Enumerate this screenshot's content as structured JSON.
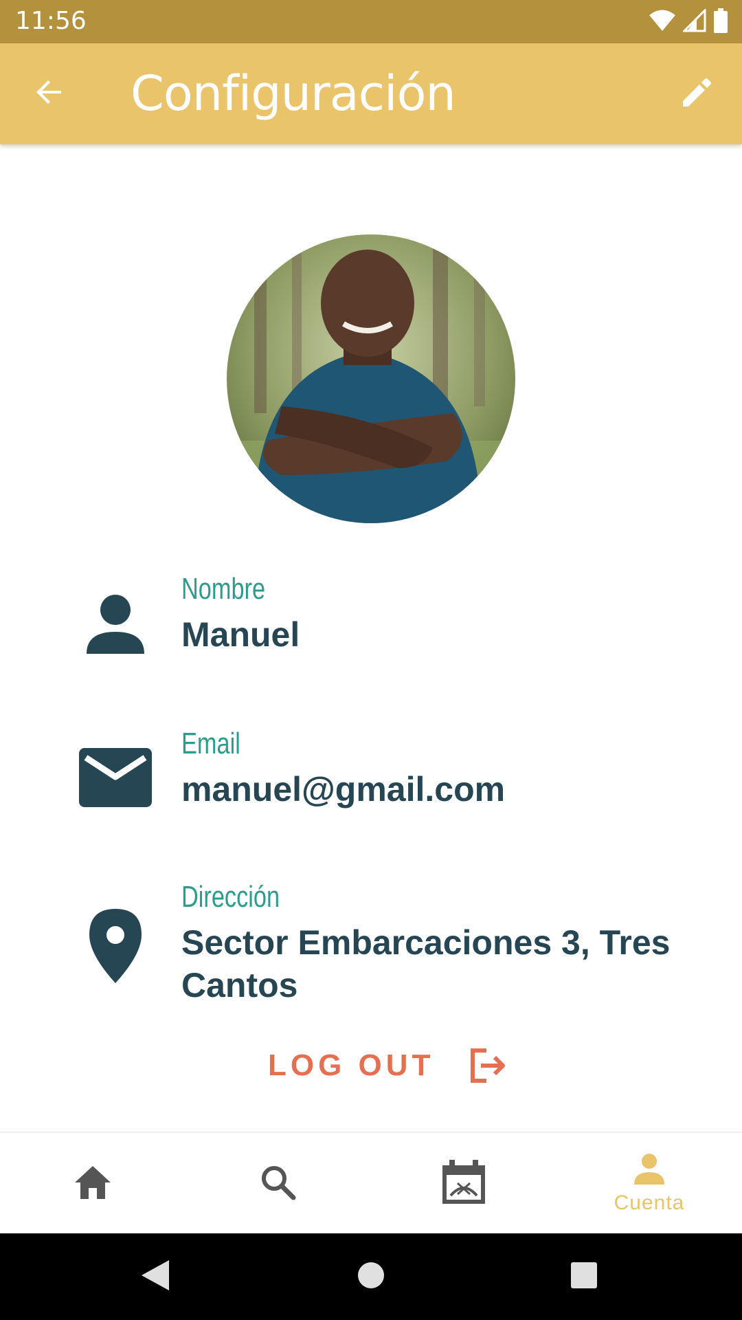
{
  "status_bar": {
    "time": "11:56"
  },
  "app_bar": {
    "title": "Configuración",
    "back_icon": "arrow-back-icon",
    "edit_icon": "pencil-icon"
  },
  "profile": {
    "fields": [
      {
        "label": "Nombre",
        "value": "Manuel",
        "icon": "person-icon"
      },
      {
        "label": "Email",
        "value": "manuel@gmail.com",
        "icon": "mail-icon"
      },
      {
        "label": "Dirección",
        "value": "Sector Embarcaciones 3, Tres Cantos",
        "icon": "location-pin-icon"
      }
    ]
  },
  "logout": {
    "label": "LOG OUT",
    "icon": "logout-icon"
  },
  "bottom_nav": {
    "items": [
      {
        "icon": "home-icon",
        "label": ""
      },
      {
        "icon": "search-icon",
        "label": ""
      },
      {
        "icon": "calendar-icon",
        "label": ""
      },
      {
        "icon": "account-icon",
        "label": "Cuenta",
        "active": true
      }
    ]
  },
  "colors": {
    "status_bar": "#b3913d",
    "app_bar": "#e9c46a",
    "label": "#2a9d8f",
    "value": "#264653",
    "logout": "#e76f51",
    "nav_inactive": "#555555",
    "nav_active": "#e9c46a"
  }
}
